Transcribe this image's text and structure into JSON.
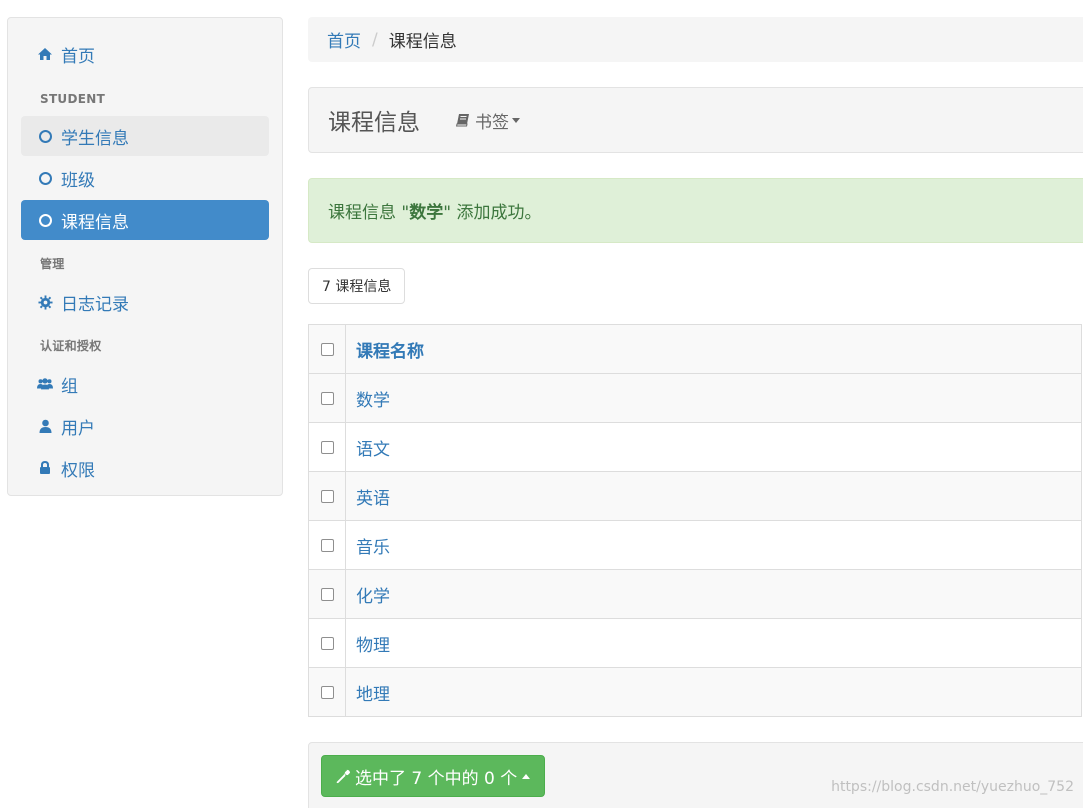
{
  "sidebar": {
    "home": "首页",
    "section_student": "STUDENT",
    "student_items": [
      "学生信息",
      "班级",
      "课程信息"
    ],
    "section_admin": "管理",
    "log": "日志记录",
    "section_auth": "认证和授权",
    "auth_items": [
      "组",
      "用户",
      "权限"
    ]
  },
  "breadcrumb": {
    "home": "首页",
    "separator": "/",
    "current": "课程信息"
  },
  "page": {
    "title": "课程信息",
    "bookmark": "书签"
  },
  "alert": {
    "prefix": "课程信息 \"",
    "name": "数学",
    "suffix": "\" 添加成功。"
  },
  "count_label": "7 课程信息",
  "table": {
    "header": "课程名称",
    "rows": [
      "数学",
      "语文",
      "英语",
      "音乐",
      "化学",
      "物理",
      "地理"
    ]
  },
  "action": {
    "label": "选中了 7 个中的 0 个"
  },
  "watermark": "https://blog.csdn.net/yuezhuo_752",
  "colors": {
    "link": "#337ab7",
    "active": "#428bca",
    "success_bg": "#dff0d8",
    "success_btn": "#5cb85c"
  }
}
